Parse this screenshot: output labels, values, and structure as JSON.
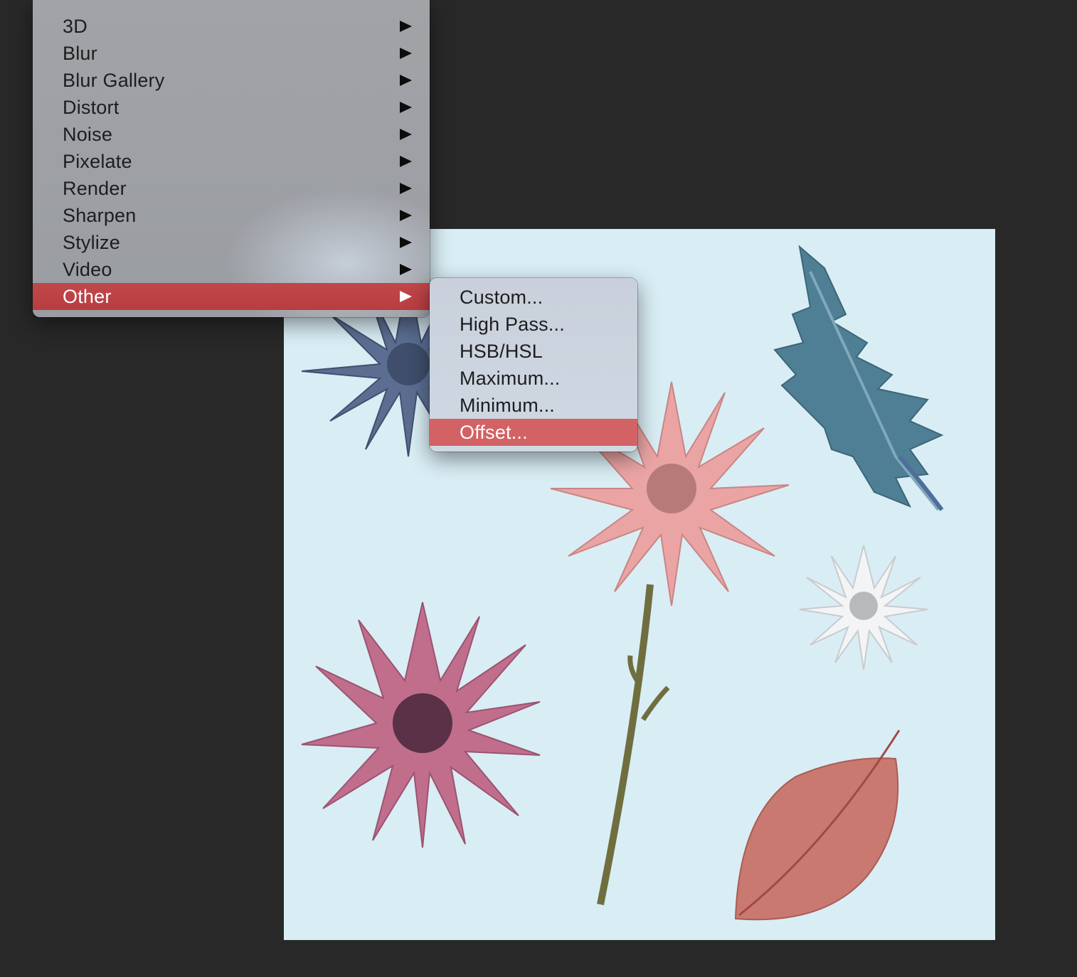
{
  "filter_menu": {
    "items": [
      {
        "label": "3D",
        "has_submenu": true
      },
      {
        "label": "Blur",
        "has_submenu": true
      },
      {
        "label": "Blur Gallery",
        "has_submenu": true
      },
      {
        "label": "Distort",
        "has_submenu": true
      },
      {
        "label": "Noise",
        "has_submenu": true
      },
      {
        "label": "Pixelate",
        "has_submenu": true
      },
      {
        "label": "Render",
        "has_submenu": true
      },
      {
        "label": "Sharpen",
        "has_submenu": true
      },
      {
        "label": "Stylize",
        "has_submenu": true
      },
      {
        "label": "Video",
        "has_submenu": true
      },
      {
        "label": "Other",
        "has_submenu": true,
        "selected": true
      }
    ]
  },
  "other_submenu": {
    "items": [
      {
        "label": "Custom..."
      },
      {
        "label": "High Pass..."
      },
      {
        "label": "HSB/HSL"
      },
      {
        "label": "Maximum..."
      },
      {
        "label": "Minimum..."
      },
      {
        "label": "Offset...",
        "selected": true
      }
    ]
  },
  "colors": {
    "app_background": "#282828",
    "canvas_background": "#d9edf5",
    "menu_highlight": "#bd4347",
    "submenu_highlight": "#d26263"
  }
}
